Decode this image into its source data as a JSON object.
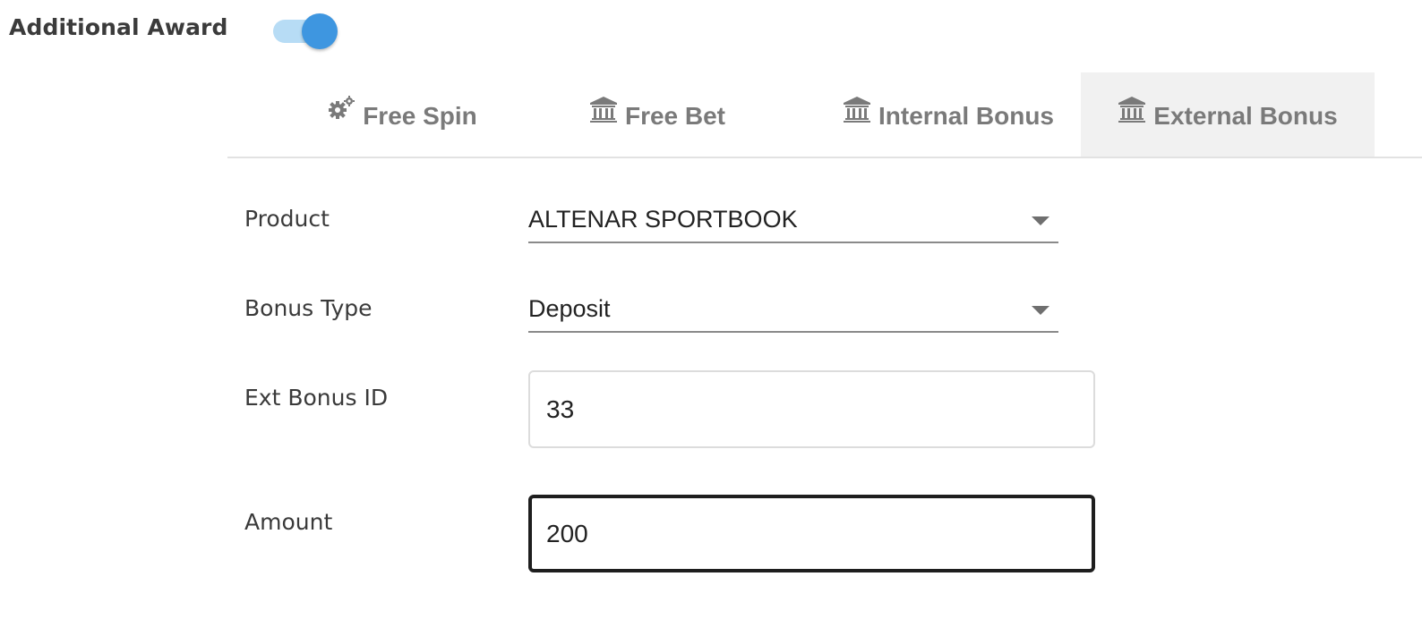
{
  "award": {
    "label": "Additional Award",
    "toggle_on": true,
    "toggle_track_color": "#b7dcf5",
    "toggle_thumb_color": "#3e96e0"
  },
  "tabs": [
    {
      "label": "Free Spin",
      "icon": "gears-icon",
      "active": false
    },
    {
      "label": "Free Bet",
      "icon": "bank-icon",
      "active": false
    },
    {
      "label": "Internal Bonus",
      "icon": "bank-icon",
      "active": false
    },
    {
      "label": "External Bonus",
      "icon": "bank-icon",
      "active": true
    }
  ],
  "form": {
    "product": {
      "label": "Product",
      "value": "ALTENAR SPORTBOOK"
    },
    "bonus_type": {
      "label": "Bonus Type",
      "value": "Deposit"
    },
    "ext_bonus_id": {
      "label": "Ext Bonus ID",
      "value": "33"
    },
    "amount": {
      "label": "Amount",
      "value": "200"
    }
  }
}
